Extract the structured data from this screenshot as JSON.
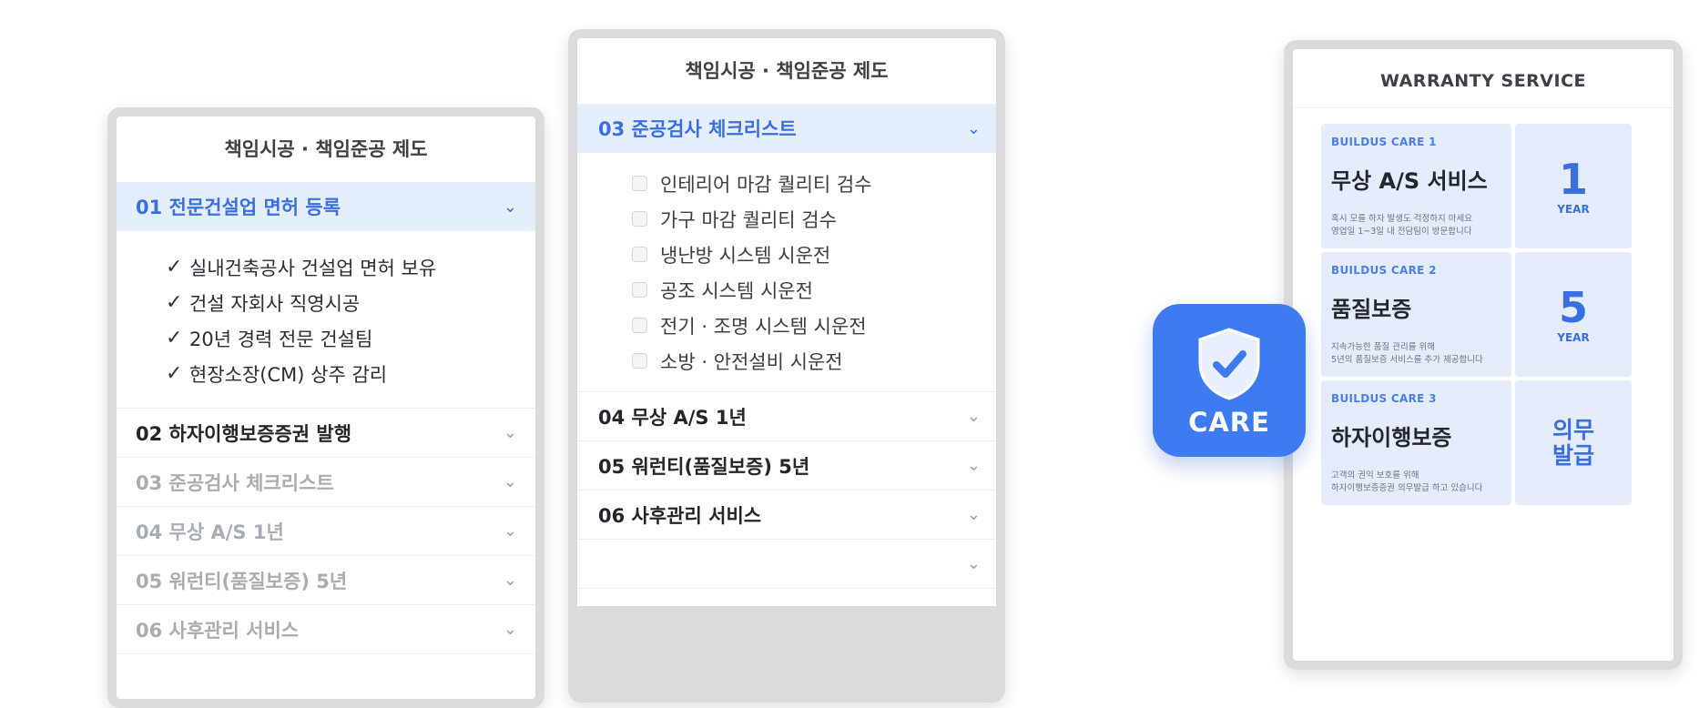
{
  "phone1": {
    "title": "책임시공 · 책임준공 제도",
    "active_item": "01 전문건설업 면허 등록",
    "checks": [
      "실내건축공사 건설업 면허 보유",
      "건설 자회사 직영시공",
      "20년 경력 전문 건설팀",
      "현장소장(CM) 상주 감리"
    ],
    "items": [
      {
        "label": "02 하자이행보증증권 발행",
        "style": "dark"
      },
      {
        "label": "03 준공검사 체크리스트",
        "style": "muted"
      },
      {
        "label": "04 무상 A/S 1년",
        "style": "muted"
      },
      {
        "label": "05 워런티(품질보증) 5년",
        "style": "muted"
      },
      {
        "label": "06 사후관리 서비스",
        "style": "muted"
      }
    ]
  },
  "phone2": {
    "title": "책임시공 · 책임준공 제도",
    "active_item": "03 준공검사 체크리스트",
    "checkboxes": [
      "인테리어 마감 퀄리티 검수",
      "가구 마감 퀄리티 검수",
      "냉난방 시스템 시운전",
      "공조 시스템 시운전",
      "전기 · 조명 시스템 시운전",
      "소방 · 안전설비 시운전"
    ],
    "items": [
      {
        "label": "04 무상 A/S 1년"
      },
      {
        "label": "05 워런티(품질보증) 5년"
      },
      {
        "label": "06 사후관리 서비스"
      },
      {
        "label": ""
      }
    ]
  },
  "care_badge": {
    "label": "CARE",
    "icon": "shield-check-icon",
    "color": "#3e7af0"
  },
  "warranty": {
    "title": "WARRANTY SERVICE",
    "cards": [
      {
        "tag": "BUILDUS CARE 1",
        "heading": "무상 A/S 서비스",
        "desc1": "혹시 모를 하자 발생도 걱정하지 마세요",
        "desc2": "영업일 1~3일 내 전담팀이 방문합니다",
        "side_num": "1",
        "side_unit": "YEAR"
      },
      {
        "tag": "BUILDUS CARE 2",
        "heading": "품질보증",
        "desc1": "지속가능한 품질 관리를 위해",
        "desc2": "5년의 품질보증 서비스를 추가 제공합니다",
        "side_num": "5",
        "side_unit": "YEAR"
      },
      {
        "tag": "BUILDUS CARE 3",
        "heading": "하자이행보증",
        "desc1": "고객의 권익 보호를 위해",
        "desc2": "하자이행보증증권 의무발급 하고 있습니다",
        "side_line1": "의무",
        "side_line2": "발급"
      }
    ]
  },
  "colors": {
    "accent": "#3a6fe0",
    "active_bg": "#e5eefb",
    "card_bg": "#e5ecfb",
    "frame": "#dadbdd"
  }
}
